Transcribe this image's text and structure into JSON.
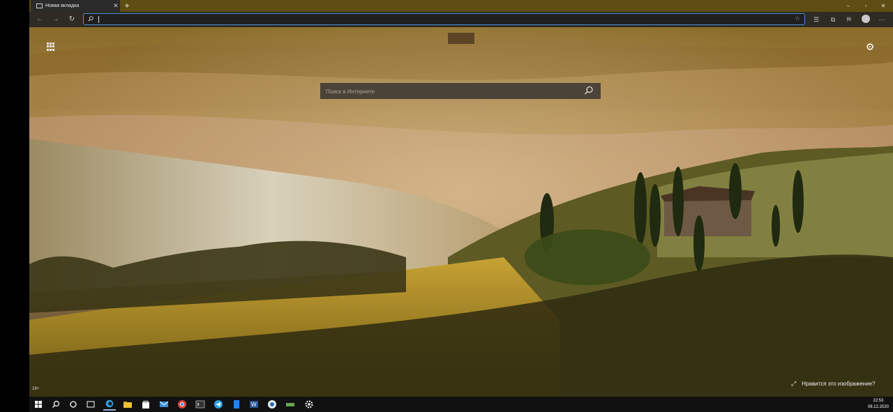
{
  "tab": {
    "title": "Новая вкладка",
    "close_glyph": "✕"
  },
  "newtab": {
    "glyph": "+"
  },
  "window": {
    "minimize": "–",
    "maximize": "▫",
    "close": "✕"
  },
  "nav": {
    "back": "←",
    "forward": "→",
    "refresh": "↻"
  },
  "address": {
    "value": "",
    "placeholder": ""
  },
  "toolbar": {
    "star": "☆",
    "collections": "☰",
    "extensions": "⧉",
    "reading": "⛿",
    "more": "···"
  },
  "newtab_page": {
    "search_placeholder": "Поиск в Интернете",
    "age_badge": "18+",
    "like_text": "Нравится это изображение?",
    "expand_glyph": "⤢",
    "settings_glyph": "⚙"
  },
  "taskbar": {
    "time": "22:53",
    "date": "08.12.2020"
  },
  "colors": {
    "tabbar": "#5e4d12",
    "accent": "#4a90d9"
  }
}
